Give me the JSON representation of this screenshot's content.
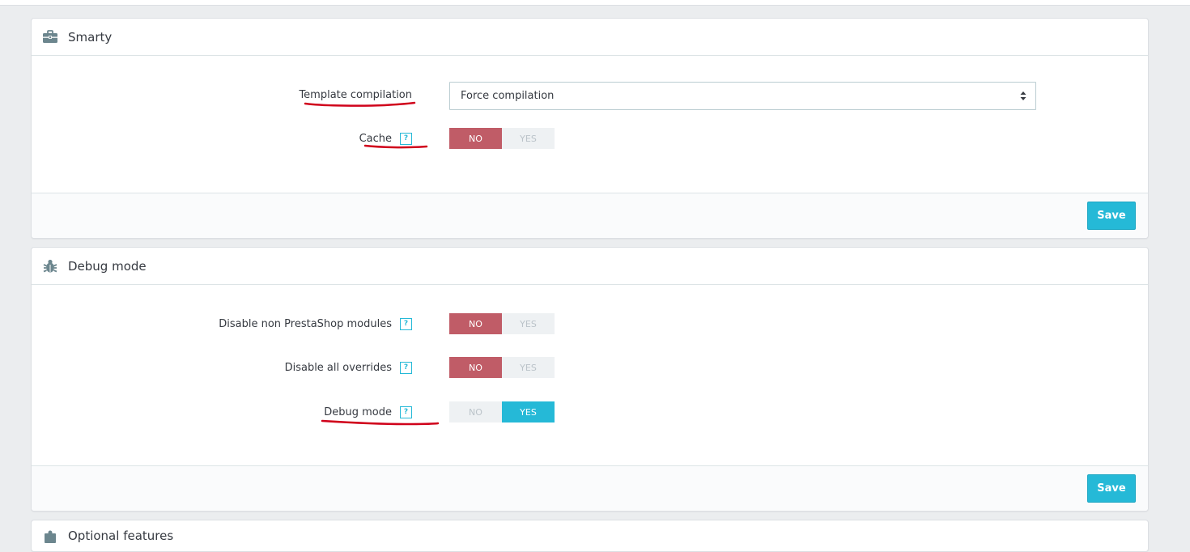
{
  "smarty": {
    "title": "Smarty",
    "fields": {
      "template_compilation": {
        "label": "Template compilation",
        "value": "Force compilation"
      },
      "cache": {
        "label": "Cache",
        "help": "?",
        "no": "NO",
        "yes": "YES",
        "selected": "NO"
      }
    },
    "save_label": "Save"
  },
  "debug": {
    "title": "Debug mode",
    "fields": {
      "disable_non_prestashop": {
        "label": "Disable non PrestaShop modules",
        "help": "?",
        "no": "NO",
        "yes": "YES",
        "selected": "NO"
      },
      "disable_overrides": {
        "label": "Disable all overrides",
        "help": "?",
        "no": "NO",
        "yes": "YES",
        "selected": "NO"
      },
      "debug_mode": {
        "label": "Debug mode",
        "help": "?",
        "no": "NO",
        "yes": "YES",
        "selected": "YES"
      }
    },
    "save_label": "Save"
  },
  "optional": {
    "title": "Optional features"
  },
  "colors": {
    "accent": "#25b9d7",
    "no_active": "#c05c67",
    "annotation": "#d0021b"
  },
  "icons": {
    "smarty": "briefcase-icon",
    "debug": "bug-icon",
    "optional": "puzzle-icon",
    "help": "question-icon",
    "select": "sort-arrows-icon"
  }
}
